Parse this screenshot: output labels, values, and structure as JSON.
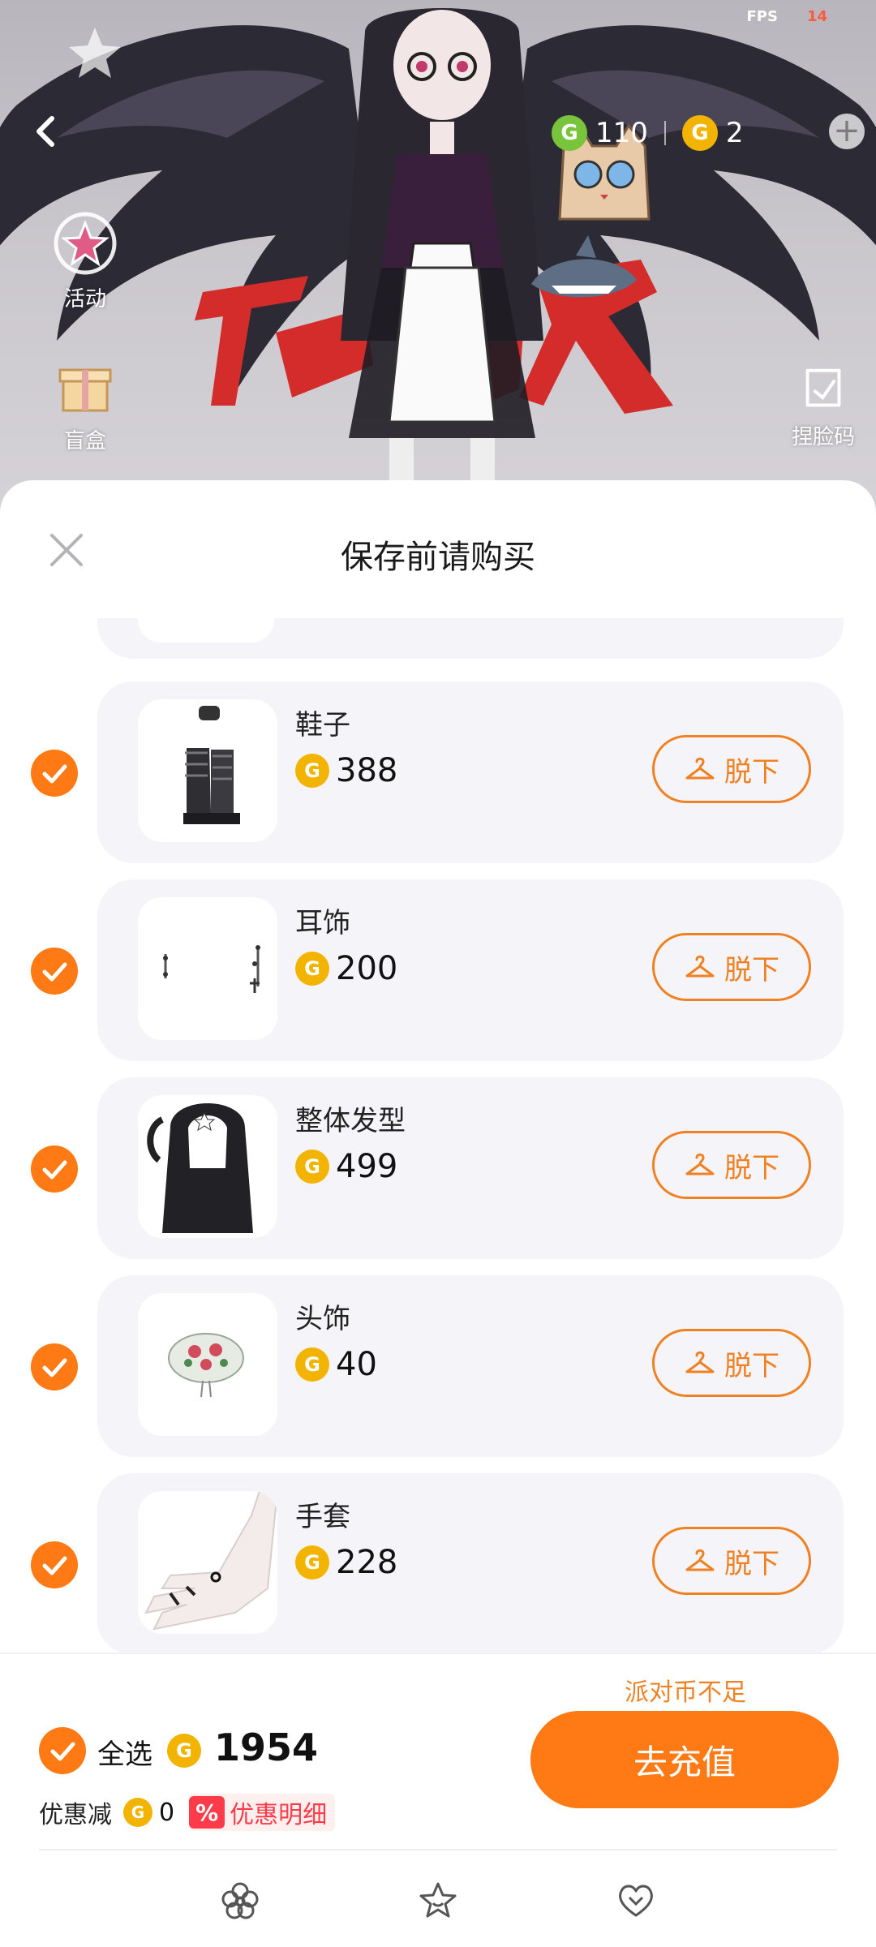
{
  "status": {
    "fps_label": "FPS",
    "fps_value": "14"
  },
  "scene": {
    "side_buttons": [
      {
        "label": "活动",
        "icon": "star-badge-icon"
      },
      {
        "label": "盲盒",
        "icon": "gift-box-icon"
      },
      {
        "label": "捏脸码",
        "icon": "face-code-icon"
      }
    ],
    "currency": [
      {
        "icon": "green-g-coin-icon",
        "value": "110",
        "color": "#78c43a"
      },
      {
        "icon": "gold-g-coin-icon",
        "value": "2",
        "color": "#f2b400"
      }
    ]
  },
  "sheet": {
    "title": "保存前请购买",
    "items": [
      {
        "name": "鞋子",
        "price": "388",
        "remove_label": "脱下",
        "thumb": "boots"
      },
      {
        "name": "耳饰",
        "price": "200",
        "remove_label": "脱下",
        "thumb": "earrings"
      },
      {
        "name": "整体发型",
        "price": "499",
        "remove_label": "脱下",
        "thumb": "hair"
      },
      {
        "name": "头饰",
        "price": "40",
        "remove_label": "脱下",
        "thumb": "beret"
      },
      {
        "name": "手套",
        "price": "228",
        "remove_label": "脱下",
        "thumb": "glove"
      }
    ]
  },
  "footer": {
    "insufficient_notice": "派对币不足",
    "select_all_label": "全选",
    "total": "1954",
    "discount_label": "优惠减",
    "discount_value": "0",
    "discount_badge": "%",
    "discount_detail_label": "优惠明细",
    "recharge_label": "去充值"
  },
  "colors": {
    "accent": "#ff7a14",
    "accent_outline": "#f08122",
    "coin_gold": "#f2b400",
    "coin_green": "#78c43a",
    "discount_red": "#ff3b4a"
  },
  "tabbar": [
    {
      "icon": "flower-icon"
    },
    {
      "icon": "star-icon"
    },
    {
      "icon": "heart-icon"
    }
  ]
}
